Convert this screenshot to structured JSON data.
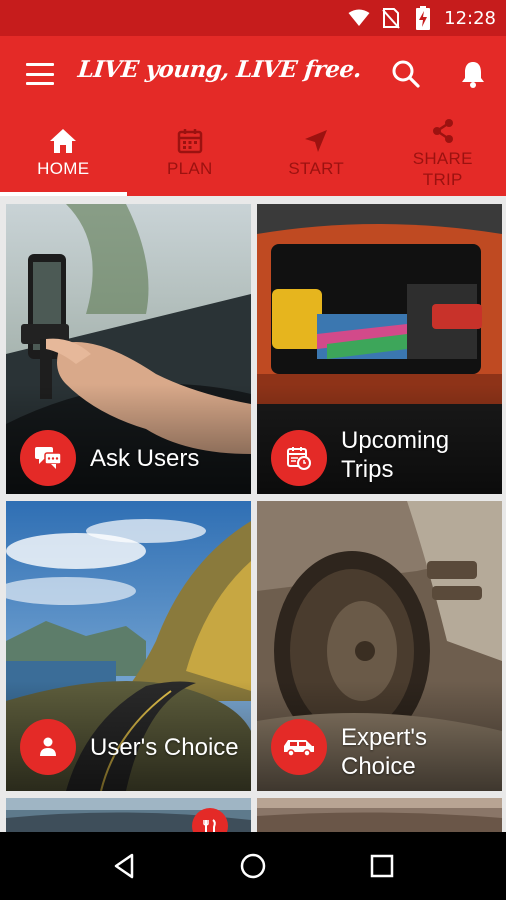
{
  "status_bar": {
    "time": "12:28",
    "icons": [
      "wifi-icon",
      "no-sim-icon",
      "battery-charging-icon"
    ]
  },
  "app_bar": {
    "brand_text": "LIVE young, LIVE free.",
    "icons": [
      "menu-icon",
      "search-icon",
      "bell-icon"
    ]
  },
  "tabs": [
    {
      "label": "HOME",
      "icon": "home-icon",
      "active": true
    },
    {
      "label": "PLAN",
      "icon": "calendar-icon",
      "active": false
    },
    {
      "label": "START",
      "icon": "navigation-arrow-icon",
      "active": false
    },
    {
      "label": "SHARE\nTRIP",
      "label_line1": "SHARE",
      "label_line2": "TRIP",
      "icon": "share-icon",
      "active": false
    }
  ],
  "tiles": [
    {
      "label": "Ask Users",
      "icon": "chat-bubbles-icon",
      "scene": "hand tapping phone mounted in car dashboard"
    },
    {
      "label_line1": "Upcoming",
      "label_line2": "Trips",
      "icon": "calendar-clock-icon",
      "scene": "open car boot loaded with luggage"
    },
    {
      "label": "User's Choice",
      "icon": "person-icon",
      "scene": "coastal mountain highway under blue sky"
    },
    {
      "label_line1": "Expert's",
      "label_line2": "Choice",
      "icon": "suv-icon",
      "scene": "muddy off-road tyre"
    },
    {
      "icon": "restaurant-icon"
    },
    {}
  ],
  "colors": {
    "primary": "#e42a27",
    "status_bar": "#c61c1c",
    "inactive_tab": "#9c1210",
    "nav_bar": "#000000"
  },
  "nav_bar": {
    "buttons": [
      "back-icon",
      "home-circle-icon",
      "recents-square-icon"
    ]
  }
}
